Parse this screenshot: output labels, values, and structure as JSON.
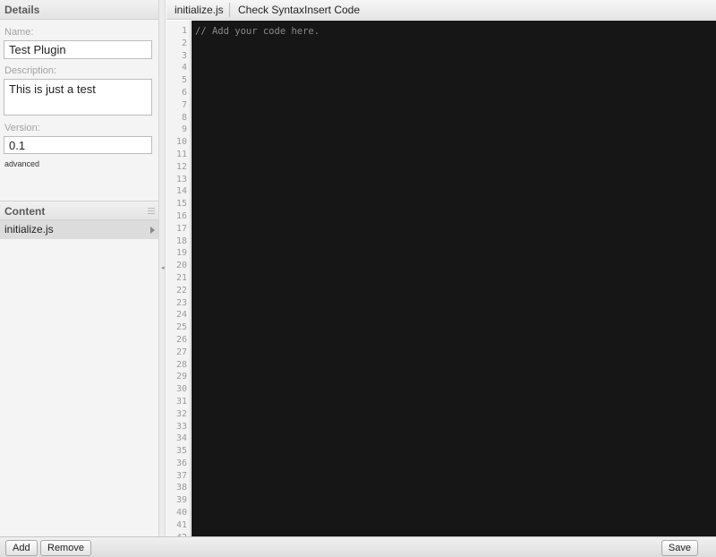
{
  "details": {
    "header": "Details",
    "name_label": "Name:",
    "name_value": "Test Plugin",
    "description_label": "Description:",
    "description_value": "This is just a test",
    "version_label": "Version:",
    "version_value": "0.1",
    "advanced_link": "advanced"
  },
  "content": {
    "header": "Content",
    "menu_icon": "list-icon",
    "items": [
      {
        "label": "initialize.js",
        "selected": true,
        "icon": "chevron-right-icon"
      }
    ]
  },
  "editor": {
    "tab_label": "initialize.js",
    "check_syntax": "Check Syntax",
    "insert_code": "Insert Code",
    "code": "// Add your code here.",
    "line_count": 42
  },
  "bottom": {
    "add": "Add",
    "remove": "Remove",
    "save": "Save"
  }
}
